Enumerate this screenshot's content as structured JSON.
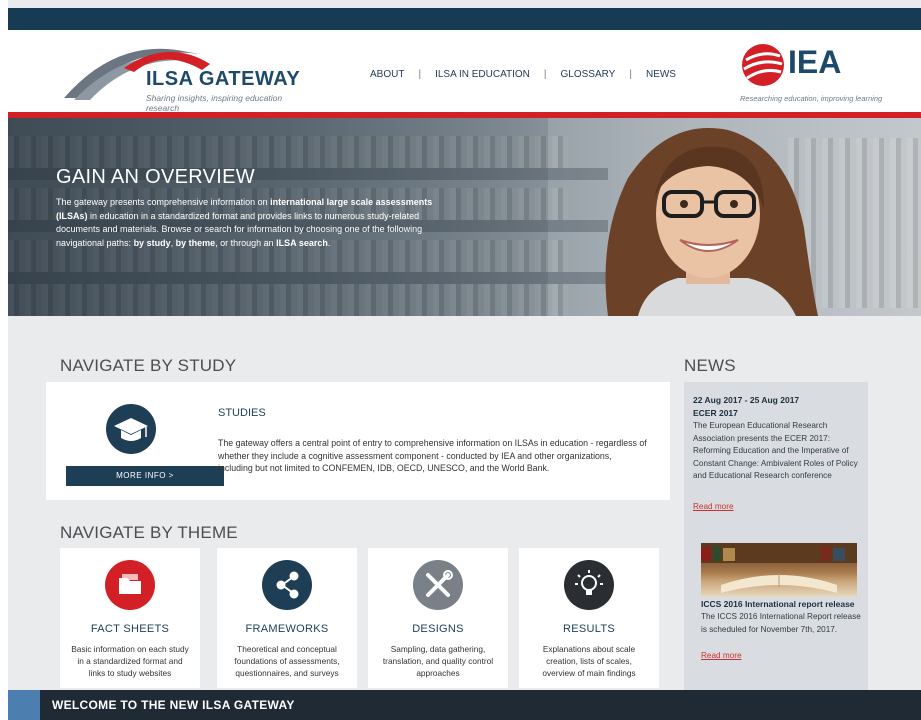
{
  "header": {
    "logo_title": "ILSA GATEWAY",
    "logo_tagline": "Sharing insights, inspiring education research",
    "nav": [
      "ABOUT",
      "ILSA IN EDUCATION",
      "GLOSSARY",
      "NEWS"
    ],
    "partner_logo": "IEA",
    "partner_tagline": "Researching education, improving learning"
  },
  "hero": {
    "title": "GAIN AN OVERVIEW",
    "text_parts": [
      "The gateway presents comprehensive information on ",
      "international large scale assessments (ILSAs)",
      " in education in a standardized format and provides links to numerous study-related documents and materials. Browse or search for information by choosing one of the following navigational paths: ",
      "by study",
      ", ",
      "by theme",
      ", or through an ",
      "ILSA search",
      "."
    ]
  },
  "study": {
    "section_title": "NAVIGATE BY STUDY",
    "heading": "STUDIES",
    "text": "The gateway offers a central point of entry to comprehensive information on ILSAs in education - regardless of whether they include a cognitive assessment component - conducted by IEA and other organizations, including but not limited to CONFEMEN, IDB, OECD, UNESCO, and the World Bank.",
    "button": "MORE INFO >",
    "icon": "graduation-cap-icon"
  },
  "theme": {
    "section_title": "NAVIGATE BY THEME",
    "cards": [
      {
        "title": "FACT SHEETS",
        "text": "Basic information on each study in a standardized format and links to study websites",
        "icon": "folder-icon",
        "color": "#d32027"
      },
      {
        "title": "FRAMEWORKS",
        "text": "Theoretical and conceptual foundations of assessments, questionnaires, and surveys",
        "icon": "share-network-icon",
        "color": "#1d3e55"
      },
      {
        "title": "DESIGNS",
        "text": "Sampling, data gathering, translation, and quality control approaches",
        "icon": "tools-icon",
        "color": "#7a8088"
      },
      {
        "title": "RESULTS",
        "text": "Explanations about scale creation, lists of scales, overview of main findings",
        "icon": "lightbulb-icon",
        "color": "#2a2e33"
      }
    ]
  },
  "news": {
    "section_title": "NEWS",
    "item1": {
      "date": "22 Aug 2017 - 25 Aug 2017",
      "title": "ECER 2017",
      "text": "The European Educational Research Association presents the ECER 2017: Reforming Education and the Imperative of Constant Change: Ambivalent Roles of Policy and Educational Research conference",
      "link": "Read more"
    },
    "item2": {
      "title": "ICCS 2016 International report release",
      "text": "The ICCS 2016 International Report release is scheduled for November 7th, 2017.",
      "link": "Read more"
    }
  },
  "footer": {
    "banner": "WELCOME TO THE NEW ILSA GATEWAY"
  }
}
